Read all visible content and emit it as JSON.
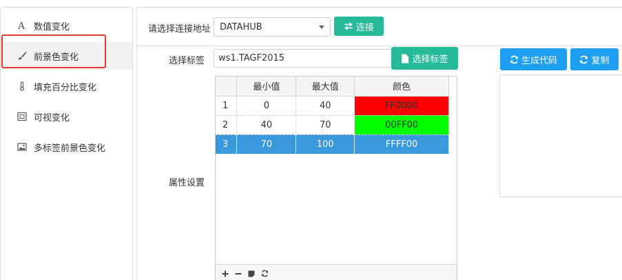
{
  "sidebar": {
    "items": [
      {
        "label": "数值变化",
        "icon": "letter-a-icon"
      },
      {
        "label": "前景色变化",
        "icon": "brush-icon"
      },
      {
        "label": "填充百分比变化",
        "icon": "thermometer-icon"
      },
      {
        "label": "可视变化",
        "icon": "visibility-frame-icon"
      },
      {
        "label": "多标签前景色变化",
        "icon": "image-icon"
      }
    ],
    "active_index": 1
  },
  "connection": {
    "label": "请选择连接地址",
    "selected": "DATAHUB",
    "connect_label": "连接"
  },
  "tag": {
    "label": "选择标签",
    "value": "ws1.TAGF2015",
    "select_label": "选择标签"
  },
  "actions": {
    "generate_label": "生成代码",
    "copy_label": "复制"
  },
  "properties": {
    "label": "属性设置",
    "columns": [
      "最小值",
      "最大值",
      "颜色"
    ],
    "rows": [
      {
        "idx": "1",
        "min": "0",
        "max": "40",
        "color": "FF0000",
        "color_hex": "#ff0000"
      },
      {
        "idx": "2",
        "min": "40",
        "max": "70",
        "color": "00FF00",
        "color_hex": "#00ff00"
      },
      {
        "idx": "3",
        "min": "70",
        "max": "100",
        "color": "FFFF00",
        "color_hex": "#3a98dc"
      }
    ],
    "selected_row": 2
  },
  "colors": {
    "teal": "#26b99a",
    "blue": "#1e9ff2",
    "highlight": "#e53935",
    "selection": "#3a98dc"
  }
}
